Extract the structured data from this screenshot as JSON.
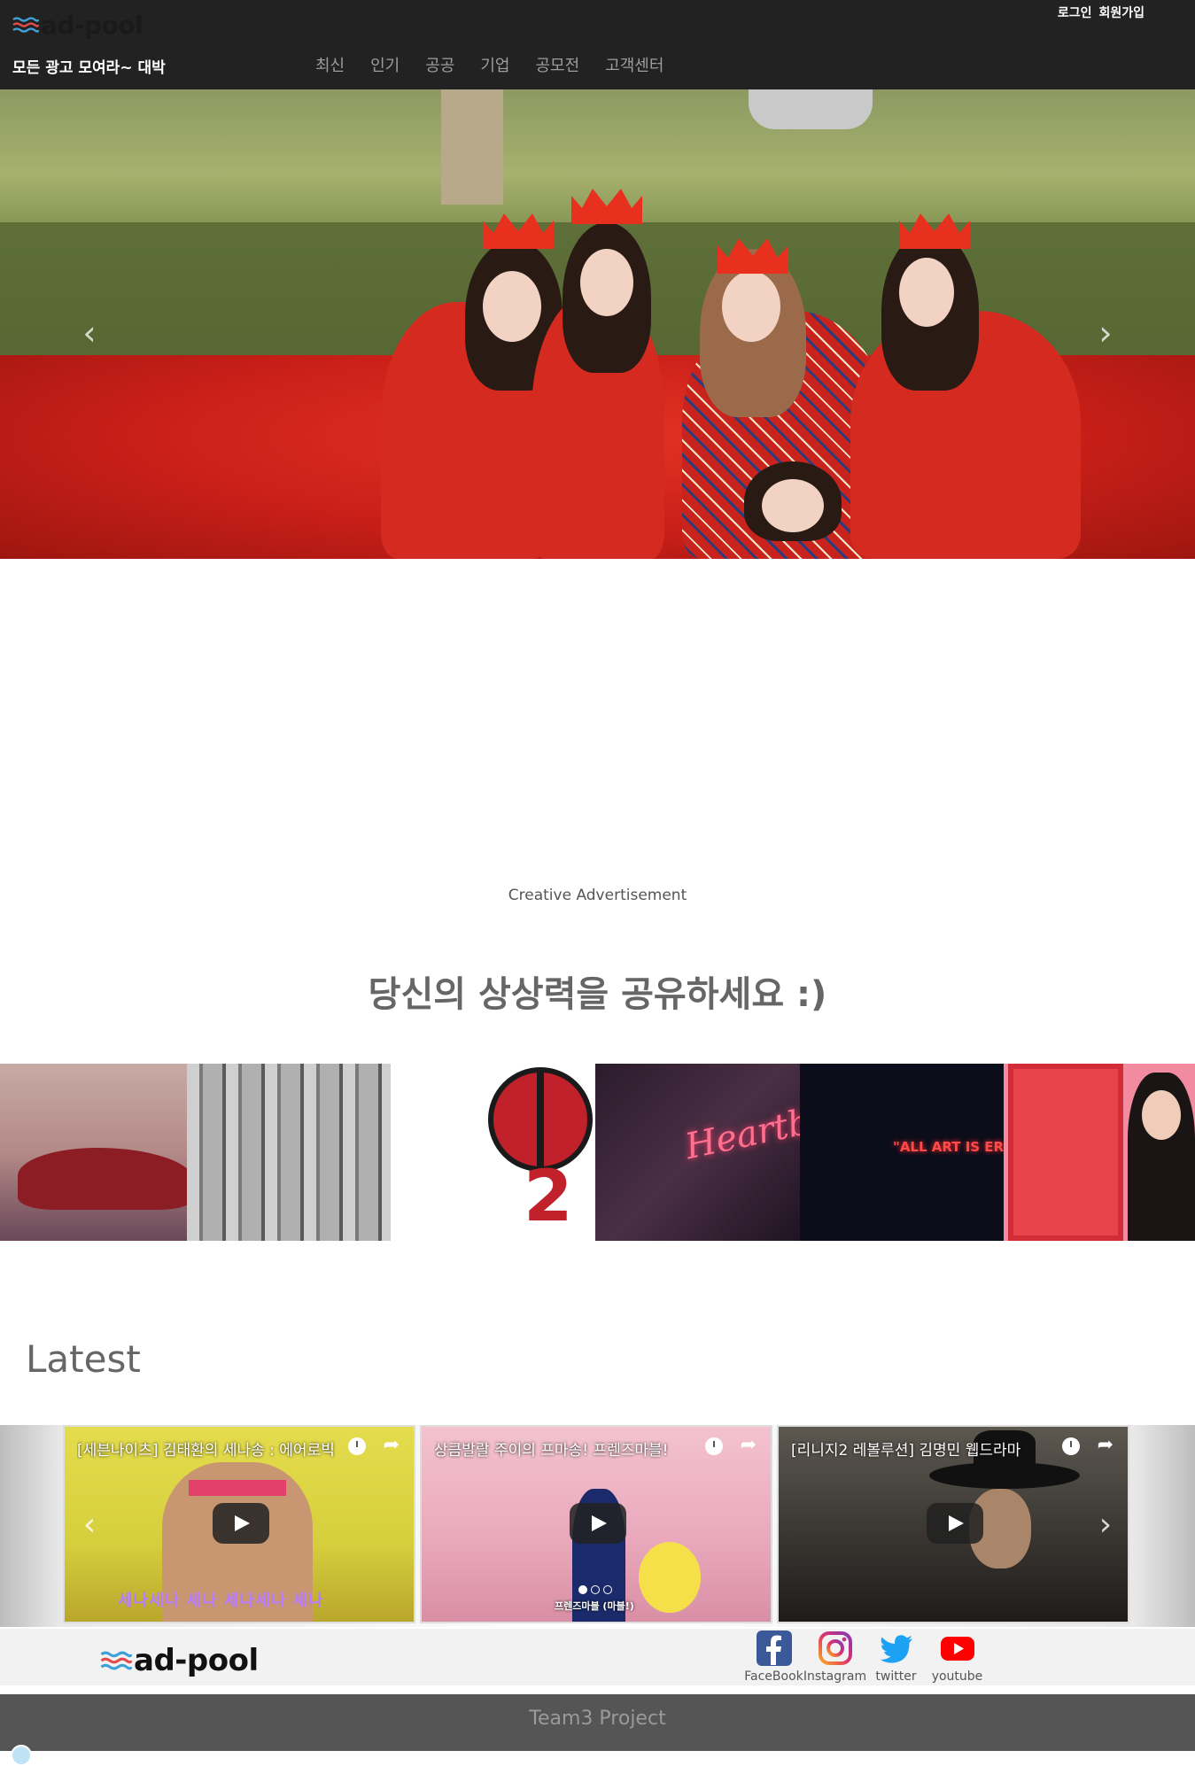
{
  "header": {
    "logo_text": "ad-pool",
    "tagline": "모든 광고 모여라~ 대박",
    "auth": {
      "login": "로그인",
      "signup": "회원가입"
    },
    "nav": [
      "최신",
      "인기",
      "공공",
      "기업",
      "공모전",
      "고객센터"
    ]
  },
  "hero": {
    "prev": "‹",
    "next": "›"
  },
  "creative": {
    "subtitle": "Creative Advertisement",
    "title": "당신의 상상력을 공유하세요 :)"
  },
  "gallery": {
    "neon_text": "Heartbrea",
    "art_text": "\"ALL ART IS EROT",
    "dp_text": "2"
  },
  "latest": {
    "title": "Latest",
    "prev": "‹",
    "next": "›",
    "videos": [
      {
        "title": "[세븐나이츠] 김태환의 세나송 : 에어로빅",
        "lyric": "세나세나 세나 세나세나 세나"
      },
      {
        "title": "상큼발랄 주이의 프마송! 프렌즈마블!",
        "caption": "프렌즈마블 (마블!)"
      },
      {
        "title": "[리니지2 레볼루션] 김명민 웹드라마"
      }
    ]
  },
  "footer": {
    "logo_text": "ad-pool",
    "social": [
      "FaceBook",
      "Instagram",
      "twitter",
      "youtube"
    ],
    "project": "Team3 Project"
  },
  "colors": {
    "header_bg": "#222222",
    "nav_text": "#9d9d9d",
    "accent_red": "#d42a1f",
    "footer_bottom": "#555555",
    "facebook": "#3b5998",
    "twitter": "#1da1f2",
    "youtube": "#ff0000"
  },
  "icons": [
    "waves-logo-icon",
    "prev-arrow-icon",
    "next-arrow-icon",
    "clock-icon",
    "share-icon",
    "play-icon",
    "facebook-icon",
    "instagram-icon",
    "twitter-icon",
    "youtube-icon"
  ]
}
